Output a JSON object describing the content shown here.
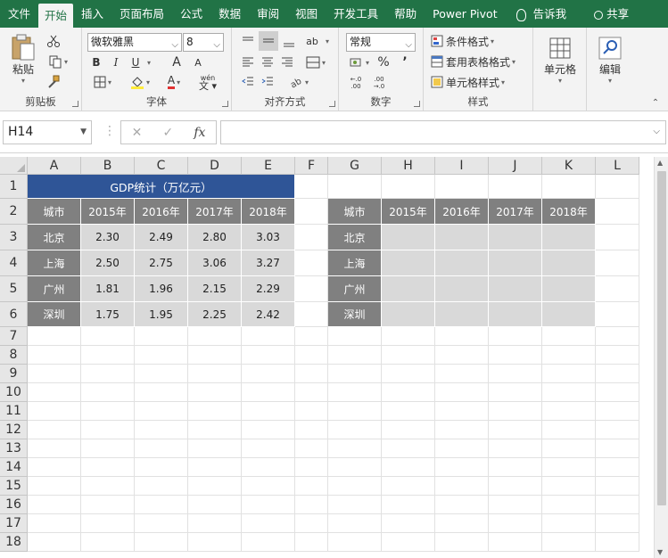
{
  "tabs": [
    "文件",
    "开始",
    "插入",
    "页面布局",
    "公式",
    "数据",
    "审阅",
    "视图",
    "开发工具",
    "帮助",
    "Power Pivot"
  ],
  "active_tab": "开始",
  "tell_me": "告诉我",
  "share": "共享",
  "ribbon": {
    "clipboard": {
      "label": "剪贴板",
      "paste": "粘贴"
    },
    "font": {
      "label": "字体",
      "font_name": "微软雅黑",
      "font_size": "8",
      "bold": "B",
      "italic": "I",
      "underline": "U",
      "grow": "A",
      "shrink": "A",
      "font_color": "A",
      "phonetic": "wén"
    },
    "alignment": {
      "label": "对齐方式",
      "text_dir": "ab"
    },
    "number": {
      "label": "数字",
      "format": "常规",
      "percent": "%",
      "comma": "’",
      "inc_dec": "←.0\n.00",
      "dec_dec": ".00\n→.0"
    },
    "styles": {
      "label": "样式",
      "conditional": "条件格式",
      "table": "套用表格格式",
      "cell_styles": "单元格样式"
    },
    "cells": {
      "label": "单元格"
    },
    "editing": {
      "label": "编辑"
    }
  },
  "formula_bar": {
    "name_box": "H14",
    "cancel": "✕",
    "enter": "✓",
    "fx": "fx",
    "formula": ""
  },
  "columns": [
    "A",
    "B",
    "C",
    "D",
    "E",
    "F",
    "G",
    "H",
    "I",
    "J",
    "K",
    "L"
  ],
  "rows": [
    "1",
    "2",
    "3",
    "4",
    "5",
    "6",
    "7",
    "8",
    "9",
    "10",
    "11",
    "12",
    "13",
    "14",
    "15",
    "16",
    "17",
    "18"
  ],
  "table1": {
    "title": "GDP统计（万亿元）",
    "header": [
      "城市",
      "2015年",
      "2016年",
      "2017年",
      "2018年"
    ],
    "rows": [
      [
        "北京",
        "2.30",
        "2.49",
        "2.80",
        "3.03"
      ],
      [
        "上海",
        "2.50",
        "2.75",
        "3.06",
        "3.27"
      ],
      [
        "广州",
        "1.81",
        "1.96",
        "2.15",
        "2.29"
      ],
      [
        "深圳",
        "1.75",
        "1.95",
        "2.25",
        "2.42"
      ]
    ]
  },
  "table2": {
    "header": [
      "城市",
      "2015年",
      "2016年",
      "2017年",
      "2018年"
    ],
    "cities": [
      "北京",
      "上海",
      "广州",
      "深圳"
    ]
  },
  "colors": {
    "ribbon": "#217346",
    "title_fill": "#2f5597",
    "header_fill": "#808080",
    "value_fill": "#d9d9d9"
  }
}
